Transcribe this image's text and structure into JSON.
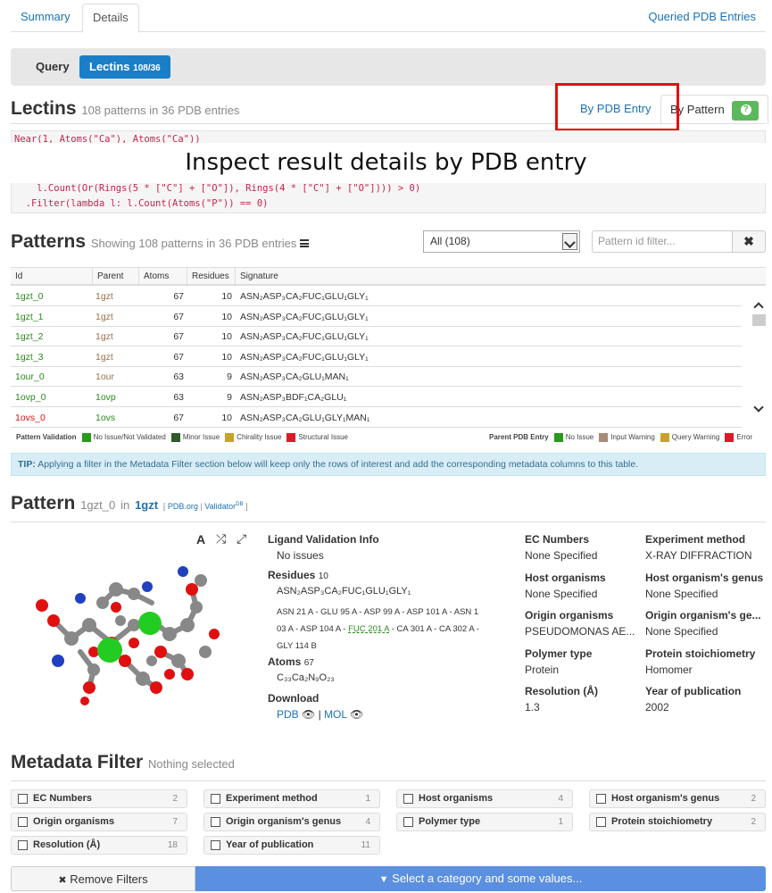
{
  "tabs": {
    "summary": "Summary",
    "details": "Details",
    "queried": "Queried PDB Entries"
  },
  "querybar": {
    "query": "Query",
    "lectins": "Lectins",
    "lectins_count": "108/36"
  },
  "lectins": {
    "title": "Lectins",
    "subtitle": "108 patterns in 36 PDB entries",
    "view_by_entry": "By PDB Entry",
    "view_by_pattern": "By Pattern",
    "code_line0": "Near(1, Atoms(\"Ca\"), Atoms(\"Ca\"))",
    "code_line1": "    l.Count(Or(Rings(5 * [\"C\"] + [\"O\"]), Rings(4 * [\"C\"] + [\"O\"]))) > 0)",
    "code_line2": "  .Filter(lambda l: l.Count(Atoms(\"P\")) == 0)"
  },
  "overlay": "Inspect result details by PDB entry",
  "patterns": {
    "title": "Patterns",
    "subtitle": "Showing 108 patterns in 36 PDB entries",
    "filter_select": "All (108)",
    "filter_placeholder": "Pattern id filter...",
    "columns": [
      "Id",
      "Parent",
      "Atoms",
      "Residues",
      "Signature"
    ],
    "rows": [
      {
        "id": "1gzt_0",
        "parent": "1gzt",
        "atoms": "67",
        "residues": "10",
        "sig": "ASN₂ASP₃CA₂FUC₁GLU₁GLY₁",
        "id_color": "green",
        "parent_color": "brown"
      },
      {
        "id": "1gzt_1",
        "parent": "1gzt",
        "atoms": "67",
        "residues": "10",
        "sig": "ASN₂ASP₃CA₂FUC₁GLU₁GLY₁",
        "id_color": "green",
        "parent_color": "brown"
      },
      {
        "id": "1gzt_2",
        "parent": "1gzt",
        "atoms": "67",
        "residues": "10",
        "sig": "ASN₂ASP₃CA₂FUC₁GLU₁GLY₁",
        "id_color": "green",
        "parent_color": "brown"
      },
      {
        "id": "1gzt_3",
        "parent": "1gzt",
        "atoms": "67",
        "residues": "10",
        "sig": "ASN₂ASP₃CA₂FUC₁GLU₁GLY₁",
        "id_color": "green",
        "parent_color": "brown"
      },
      {
        "id": "1our_0",
        "parent": "1our",
        "atoms": "63",
        "residues": "9",
        "sig": "ASN₂ASP₃CA₂GLU₁MAN₁",
        "id_color": "green",
        "parent_color": "brown"
      },
      {
        "id": "1ovp_0",
        "parent": "1ovp",
        "atoms": "63",
        "residues": "9",
        "sig": "ASN₂ASP₃BDF₁CA₂GLU₁",
        "id_color": "green",
        "parent_color": "green"
      },
      {
        "id": "1ovs_0",
        "parent": "1ovs",
        "atoms": "67",
        "residues": "10",
        "sig": "ASN₂ASP₃CA₂GLU₁GLY₁MAN₁",
        "id_color": "red",
        "parent_color": "green"
      }
    ],
    "legend_validation": {
      "label": "Pattern Validation",
      "items": [
        "No Issue/Not Validated",
        "Minor Issue",
        "Chirality Issue",
        "Structural Issue"
      ],
      "colors": [
        "#2a9a1c",
        "#2f5a2a",
        "#c8a22a",
        "#e0192a"
      ]
    },
    "legend_parent": {
      "label": "Parent PDB Entry",
      "items": [
        "No Issue",
        "Input Warning",
        "Query Warning",
        "Error"
      ],
      "colors": [
        "#2a9a1c",
        "#a88a78",
        "#c8a22a",
        "#e0192a"
      ]
    },
    "tip_label": "TIP:",
    "tip": "Applying a filter in the Metadata Filter section below will keep only the rows of interest and add the corresponding metadata columns to this table."
  },
  "pattern": {
    "title": "Pattern",
    "id": "1gzt_0",
    "in": "in",
    "parent": "1gzt",
    "pdborg": "PDB.org",
    "validator": "Validator",
    "validator_sup": "DB",
    "validation_label": "Ligand Validation Info",
    "validation_value": "No issues",
    "residues_label": "Residues",
    "residues_count": "10",
    "residues_sig": "ASN₂ASP₃CA₂FUC₁GLU₁GLY₁",
    "residues_list_a": "ASN 21 A - GLU 95 A - ASP 99 A - ASP 101 A - ASN 1",
    "residues_list_b1": "03 A - ASP 104 A - ",
    "residues_list_fuc": "FUC 201 A",
    "residues_list_b2": " - CA 301 A - CA 302 A -",
    "residues_list_c": "GLY 114 B",
    "atoms_label": "Atoms",
    "atoms_count": "67",
    "formula": "C₃₃Ca₂N₉O₂₃",
    "download_label": "Download",
    "download_pdb": "PDB",
    "download_mol": "MOL",
    "meta": [
      {
        "label": "EC Numbers",
        "value": "None Specified"
      },
      {
        "label": "Experiment method",
        "value": "X-RAY DIFFRACTION"
      },
      {
        "label": "Host organisms",
        "value": "None Specified"
      },
      {
        "label": "Host organism's genus",
        "value": "None Specified"
      },
      {
        "label": "Origin organisms",
        "value": "PSEUDOMONAS AE..."
      },
      {
        "label": "Origin organism's ge...",
        "value": "None Specified"
      },
      {
        "label": "Polymer type",
        "value": "Protein"
      },
      {
        "label": "Protein stoichiometry",
        "value": "Homomer"
      },
      {
        "label": "Resolution (Å)",
        "value": "1.3"
      },
      {
        "label": "Year of publication",
        "value": "2002"
      }
    ]
  },
  "metadata": {
    "title": "Metadata Filter",
    "subtitle": "Nothing selected",
    "filters": [
      {
        "label": "EC Numbers",
        "count": "2"
      },
      {
        "label": "Experiment method",
        "count": "1"
      },
      {
        "label": "Host organisms",
        "count": "4"
      },
      {
        "label": "Host organism's genus",
        "count": "2"
      },
      {
        "label": "Origin organisms",
        "count": "7"
      },
      {
        "label": "Origin organism's genus",
        "count": "4"
      },
      {
        "label": "Polymer type",
        "count": "1"
      },
      {
        "label": "Protein stoichiometry",
        "count": "2"
      },
      {
        "label": "Resolution (Å)",
        "count": "18"
      },
      {
        "label": "Year of publication",
        "count": "11"
      }
    ],
    "remove": "Remove Filters",
    "select": "Select a category and some values..."
  }
}
